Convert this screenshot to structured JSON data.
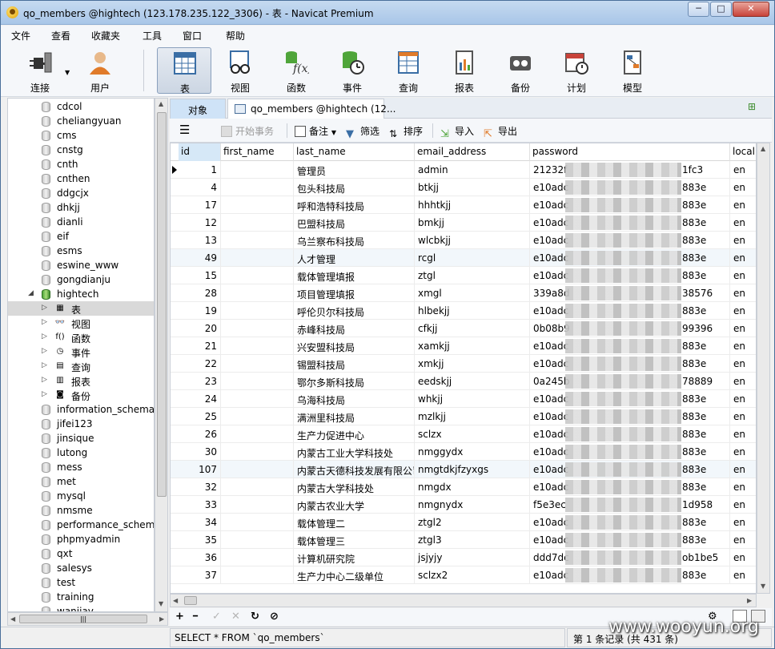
{
  "window": {
    "title": "qo_members @hightech (123.178.235.122_3306) - 表 - Navicat Premium",
    "min": "─",
    "max": "□",
    "close": "✕"
  },
  "menu": [
    "文件",
    "查看",
    "收藏夹",
    "工具",
    "窗口",
    "帮助"
  ],
  "toolbar": [
    "连接",
    "用户",
    "表",
    "视图",
    "函数",
    "事件",
    "查询",
    "报表",
    "备份",
    "计划",
    "模型"
  ],
  "tree": {
    "databases": [
      "cdcol",
      "cheliangyuan",
      "cms",
      "cnstg",
      "cnth",
      "cnthen",
      "ddgcjx",
      "dhkjj",
      "dianli",
      "eif",
      "esms",
      "eswine_www",
      "gongdianju",
      "hightech"
    ],
    "hightech_children": [
      {
        "label": "表",
        "icon": "table-icon",
        "glyph": "▦"
      },
      {
        "label": "视图",
        "icon": "view-icon",
        "glyph": "👓"
      },
      {
        "label": "函数",
        "icon": "function-icon",
        "glyph": "f()"
      },
      {
        "label": "事件",
        "icon": "event-icon",
        "glyph": "◷"
      },
      {
        "label": "查询",
        "icon": "query-icon",
        "glyph": "▤"
      },
      {
        "label": "报表",
        "icon": "report-icon",
        "glyph": "▥"
      },
      {
        "label": "备份",
        "icon": "backup-icon",
        "glyph": "◙"
      }
    ],
    "more_databases": [
      "information_schema",
      "jifei123",
      "jinsique",
      "lutong",
      "mess",
      "met",
      "mysql",
      "nmsme",
      "performance_schema",
      "phpmyadmin",
      "qxt",
      "salesys",
      "test",
      "training",
      "wanjiav"
    ]
  },
  "tabs": {
    "objects": "对象",
    "table": "qo_members @hightech (12..."
  },
  "subtoolbar": {
    "menu": "☰",
    "begin_tx": "开始事务",
    "memo": "备注",
    "filter": "筛选",
    "sort": "排序",
    "import": "导入",
    "export": "导出"
  },
  "grid": {
    "columns": [
      "id",
      "first_name",
      "last_name",
      "email_address",
      "password",
      "local"
    ],
    "rows": [
      {
        "id": "1",
        "first_name": "",
        "last_name": "管理员",
        "email": "admin",
        "pw_head": "21232f",
        "pw_tail": "1fc3",
        "local": "en"
      },
      {
        "id": "4",
        "first_name": "",
        "last_name": "包头科技局",
        "email": "btkjj",
        "pw_head": "e10adc",
        "pw_tail": "883e",
        "local": "en"
      },
      {
        "id": "17",
        "first_name": "",
        "last_name": "呼和浩特科技局",
        "email": "hhhtkjj",
        "pw_head": "e10adc",
        "pw_tail": "883e",
        "local": "en"
      },
      {
        "id": "12",
        "first_name": "",
        "last_name": "巴盟科技局",
        "email": "bmkjj",
        "pw_head": "e10adc",
        "pw_tail": "883e",
        "local": "en"
      },
      {
        "id": "13",
        "first_name": "",
        "last_name": "乌兰察布科技局",
        "email": "wlcbkjj",
        "pw_head": "e10adc",
        "pw_tail": "883e",
        "local": "en"
      },
      {
        "id": "49",
        "first_name": "",
        "last_name": "人才管理",
        "email": "rcgl",
        "pw_head": "e10adc",
        "pw_tail": "883e",
        "local": "en"
      },
      {
        "id": "15",
        "first_name": "",
        "last_name": "载体管理填报",
        "email": "ztgl",
        "pw_head": "e10adc",
        "pw_tail": "883e",
        "local": "en"
      },
      {
        "id": "28",
        "first_name": "",
        "last_name": "项目管理填报",
        "email": "xmgl",
        "pw_head": "339a8d",
        "pw_tail": "38576",
        "local": "en"
      },
      {
        "id": "19",
        "first_name": "",
        "last_name": "呼伦贝尔科技局",
        "email": "hlbekjj",
        "pw_head": "e10adc",
        "pw_tail": "883e",
        "local": "en"
      },
      {
        "id": "20",
        "first_name": "",
        "last_name": "赤峰科技局",
        "email": "cfkjj",
        "pw_head": "0b08b9",
        "pw_tail": "99396",
        "local": "en"
      },
      {
        "id": "21",
        "first_name": "",
        "last_name": "兴安盟科技局",
        "email": "xamkjj",
        "pw_head": "e10adc",
        "pw_tail": "883e",
        "local": "en"
      },
      {
        "id": "22",
        "first_name": "",
        "last_name": "锡盟科技局",
        "email": "xmkjj",
        "pw_head": "e10adc",
        "pw_tail": "883e",
        "local": "en"
      },
      {
        "id": "23",
        "first_name": "",
        "last_name": "鄂尔多斯科技局",
        "email": "eedskjj",
        "pw_head": "0a245b",
        "pw_tail": "78889",
        "local": "en"
      },
      {
        "id": "24",
        "first_name": "",
        "last_name": "乌海科技局",
        "email": "whkjj",
        "pw_head": "e10adc",
        "pw_tail": "883e",
        "local": "en"
      },
      {
        "id": "25",
        "first_name": "",
        "last_name": "满洲里科技局",
        "email": "mzlkjj",
        "pw_head": "e10adc",
        "pw_tail": "883e",
        "local": "en"
      },
      {
        "id": "26",
        "first_name": "",
        "last_name": "生产力促进中心",
        "email": "sclzx",
        "pw_head": "e10adc",
        "pw_tail": "883e",
        "local": "en"
      },
      {
        "id": "30",
        "first_name": "",
        "last_name": "内蒙古工业大学科技处",
        "email": "nmggydx",
        "pw_head": "e10adc",
        "pw_tail": "883e",
        "local": "en"
      },
      {
        "id": "107",
        "first_name": "",
        "last_name": "内蒙古天德科技发展有限公司",
        "email": "nmgtdkjfzyxgs",
        "pw_head": "e10adc",
        "pw_tail": "883e",
        "local": "en"
      },
      {
        "id": "32",
        "first_name": "",
        "last_name": "内蒙古大学科技处",
        "email": "nmgdx",
        "pw_head": "e10adc",
        "pw_tail": "883e",
        "local": "en"
      },
      {
        "id": "33",
        "first_name": "",
        "last_name": "内蒙古农业大学",
        "email": "nmgnydx",
        "pw_head": "f5e3ec",
        "pw_tail": "1d958",
        "local": "en"
      },
      {
        "id": "34",
        "first_name": "",
        "last_name": "载体管理二",
        "email": "ztgl2",
        "pw_head": "e10adc",
        "pw_tail": "883e",
        "local": "en"
      },
      {
        "id": "35",
        "first_name": "",
        "last_name": "载体管理三",
        "email": "ztgl3",
        "pw_head": "e10adc",
        "pw_tail": "883e",
        "local": "en"
      },
      {
        "id": "36",
        "first_name": "",
        "last_name": "计算机研究院",
        "email": "jsjyjy",
        "pw_head": "ddd7dc",
        "pw_tail": "ob1be5",
        "local": "en"
      },
      {
        "id": "37",
        "first_name": "",
        "last_name": "生产力中心二级单位",
        "email": "sclzx2",
        "pw_head": "e10adc",
        "pw_tail": "883e",
        "local": "en"
      }
    ]
  },
  "navbar": {
    "add": "+",
    "remove": "━",
    "apply": "✓",
    "cancel": "✕",
    "refresh": "↻",
    "stop": "⊘",
    "settings": "⚙"
  },
  "status": {
    "sql": "SELECT * FROM `qo_members`",
    "record": "第 1 条记录 (共 431 条)"
  },
  "watermark": "www.wooyun.org"
}
